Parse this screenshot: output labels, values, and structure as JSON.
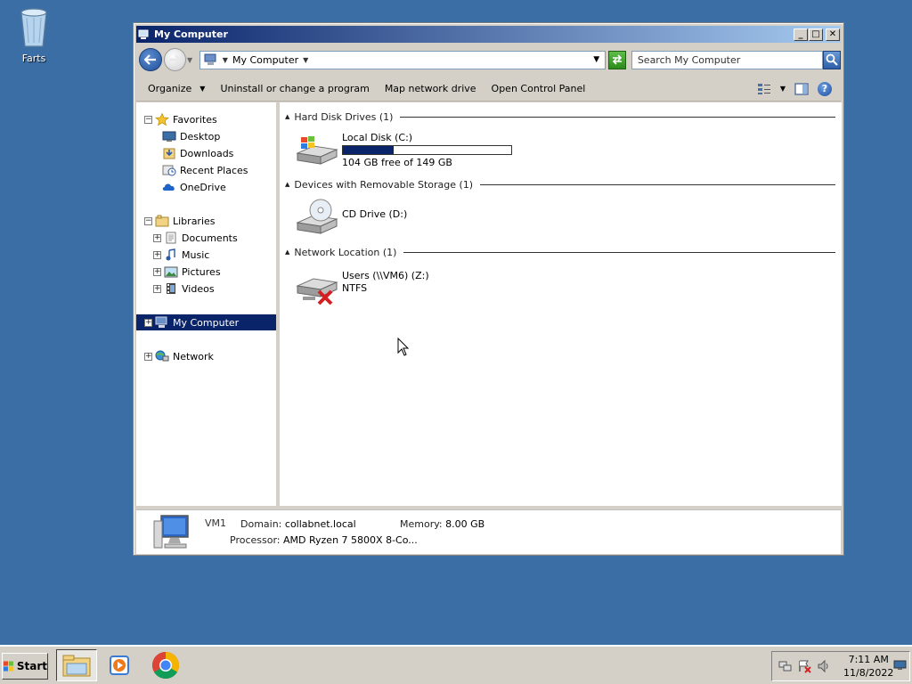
{
  "desktop": {
    "icons": [
      {
        "label": "Farts",
        "icon": "recycle-bin-icon"
      }
    ]
  },
  "window": {
    "title": "My Computer",
    "controls": {
      "minimize": "_",
      "maximize": "□",
      "close": "✕"
    }
  },
  "address_bar": {
    "crumb": "My Computer",
    "search_placeholder": "Search My Computer"
  },
  "toolbar": {
    "organize": "Organize",
    "uninstall": "Uninstall or change a program",
    "map_drive": "Map network drive",
    "control_panel": "Open Control Panel"
  },
  "nav_pane": {
    "favorites": {
      "label": "Favorites",
      "items": [
        "Desktop",
        "Downloads",
        "Recent Places",
        "OneDrive"
      ]
    },
    "libraries": {
      "label": "Libraries",
      "items": [
        "Documents",
        "Music",
        "Pictures",
        "Videos"
      ]
    },
    "my_computer": "My Computer",
    "network": "Network"
  },
  "content": {
    "groups": [
      {
        "header": "Hard Disk Drives (1)"
      },
      {
        "header": "Devices with Removable Storage (1)"
      },
      {
        "header": "Network Location (1)"
      }
    ],
    "local_disk": {
      "name": "Local Disk (C:)",
      "free_text": "104 GB free of 149 GB",
      "used_fraction": 0.3
    },
    "cd_drive": {
      "name": "CD Drive (D:)"
    },
    "network_drive": {
      "name": "Users (\\\\VM6) (Z:)",
      "fs": "NTFS"
    }
  },
  "details": {
    "computer_name": "VM1",
    "domain_label": "Domain:",
    "domain": "collabnet.local",
    "memory_label": "Memory:",
    "memory": "8.00 GB",
    "processor_label": "Processor:",
    "processor": "AMD Ryzen 7 5800X 8-Co..."
  },
  "taskbar": {
    "start": "Start",
    "time": "7:11 AM",
    "date": "11/8/2022"
  },
  "colors": {
    "desktop": "#3a6ea5",
    "selection": "#0a246a",
    "chrome": "#d4d0c8"
  }
}
